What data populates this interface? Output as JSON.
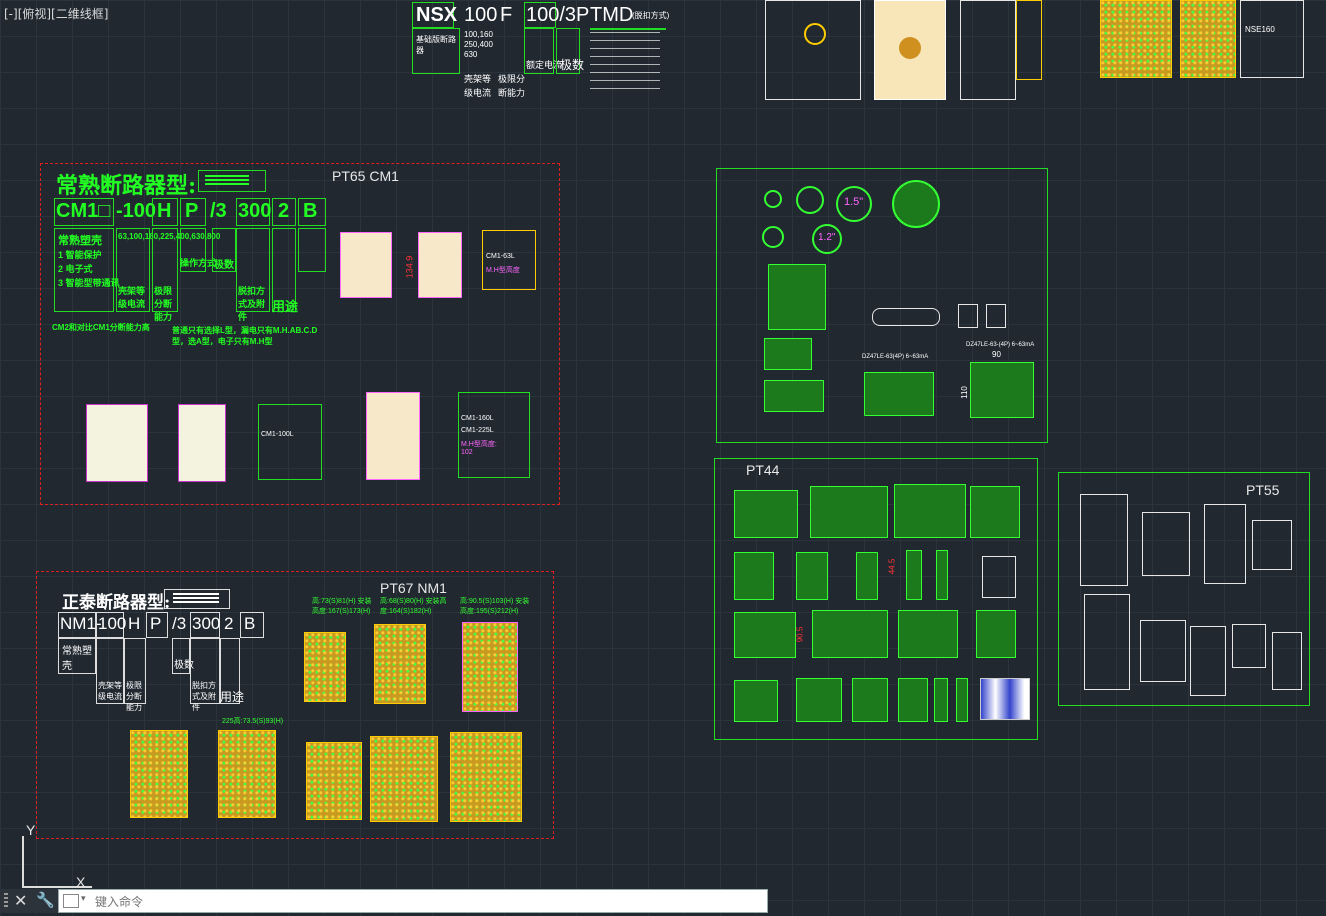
{
  "viewport": {
    "label": "[-][俯视][二维线框]"
  },
  "colors": {
    "background": "#212830",
    "green": "#22dd22",
    "red": "#e02020",
    "yellow": "#ffcc00",
    "magenta": "#ff33ff"
  },
  "top_codes": {
    "nsx": "NSX",
    "n100": "100",
    "f": "F",
    "n100_3p": "100/3P",
    "tmd": "TMD",
    "tmd_note": "(脱扣方式)",
    "col1": "基础版断路器",
    "col2a": "100,160",
    "col2b": "250,400",
    "col2c": "630",
    "col3": "额定电流",
    "col4": "极数",
    "frame_a": "壳架等",
    "frame_b": "级电流",
    "cap_a": "极限分",
    "cap_b": "断能力"
  },
  "pt65": {
    "title": "PT65 CM1",
    "heading": "常熟断路器型:",
    "codes": [
      "CM1□",
      "-100",
      "H",
      "P",
      "/3",
      "300",
      "2",
      "B"
    ],
    "sub1": "常熟塑壳",
    "sub1_items": [
      "1 智能保护",
      "2 电子式",
      "3 智能型带通讯"
    ],
    "ratings": "63,100,160,225,400,630,800",
    "frame": "壳架等级电流",
    "breaking": "极限分断能力",
    "operation": "操作方式",
    "poles": "极数",
    "trip": "脱扣方式及附件",
    "use": "用途",
    "note1": "CM2和对比CM1分断能力高",
    "note2": "普通只有选择L型，漏电只有M.H.AB.C.D型，选A型，电子只有M.H型",
    "dim_label": "134.9",
    "cm1_100l": "CM1-63L",
    "hint": "M.H型高度",
    "cm1_160l": "CM1-160L",
    "cm1_225l": "CM1-225L",
    "mh_hint": "M.H型高度:",
    "mh_val": "102",
    "cm1_100l_b": "CM1-100L"
  },
  "pt67": {
    "title": "PT67 NM1",
    "heading": "正泰断路器型:",
    "codes": [
      "NM1-",
      "100",
      "H",
      "P",
      "/3",
      "300",
      "2",
      "B"
    ],
    "sub1": "常熟塑壳",
    "frame": "壳架等级电流",
    "breaking": "极限分断能力",
    "poles": "极数",
    "trip": "脱扣方式及附件",
    "use": "用途",
    "notes": [
      "高:73(S)81(H) 安装高度:167(S)173(H)",
      "高:68(S)80(H) 安装高度:164(S)182(H)",
      "高:90.5(S)103(H) 安装高度:195(S)212(H)"
    ],
    "note4": "225高:73.5(S)93(H)"
  },
  "pt44": {
    "title": "PT44",
    "dims": [
      "44.5",
      "90.5"
    ]
  },
  "pt55": {
    "title": "PT55"
  },
  "mid_panel": {
    "label1": "1.5\"",
    "label2": "1.2\"",
    "dim90": "90",
    "dim110": "110",
    "t1": "DZ47LE-63(4P) 6~63mA",
    "t2": "DZ47LE-63-(4P) 6~63mA"
  },
  "nse_label": "NSE160",
  "ucs": {
    "y": "Y",
    "x": "X"
  },
  "command": {
    "placeholder": "键入命令"
  }
}
